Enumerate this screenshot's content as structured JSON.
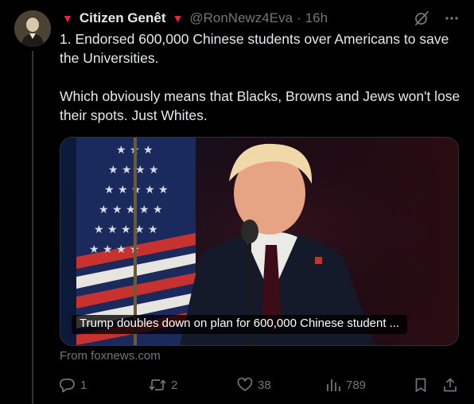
{
  "author": {
    "display_name": "Citizen Genêt",
    "handle": "@RonNewz4Eva",
    "separator": "·",
    "time": "16h",
    "badge_symbol": "▼",
    "badge_color": "#f4212e"
  },
  "tweet": {
    "text": "1. Endorsed 600,000 Chinese students over Americans to save the Universities.\n\nWhich obviously means that Blacks, Browns and Jews won't lose their spots. Just Whites."
  },
  "card": {
    "caption": "Trump doubles down on plan for 600,000 Chinese student ...",
    "source": "From foxnews.com"
  },
  "actions": {
    "replies": "1",
    "reposts": "2",
    "likes": "38",
    "views": "789"
  },
  "icons": {
    "top": [
      "grok-slash-icon",
      "more-icon"
    ],
    "actions": [
      "reply-icon",
      "repost-icon",
      "like-icon",
      "views-icon",
      "bookmark-icon",
      "share-icon"
    ]
  },
  "colors": {
    "background": "#000000",
    "text_primary": "#e7e9ea",
    "text_secondary": "#71767b",
    "border": "#2f3336"
  }
}
